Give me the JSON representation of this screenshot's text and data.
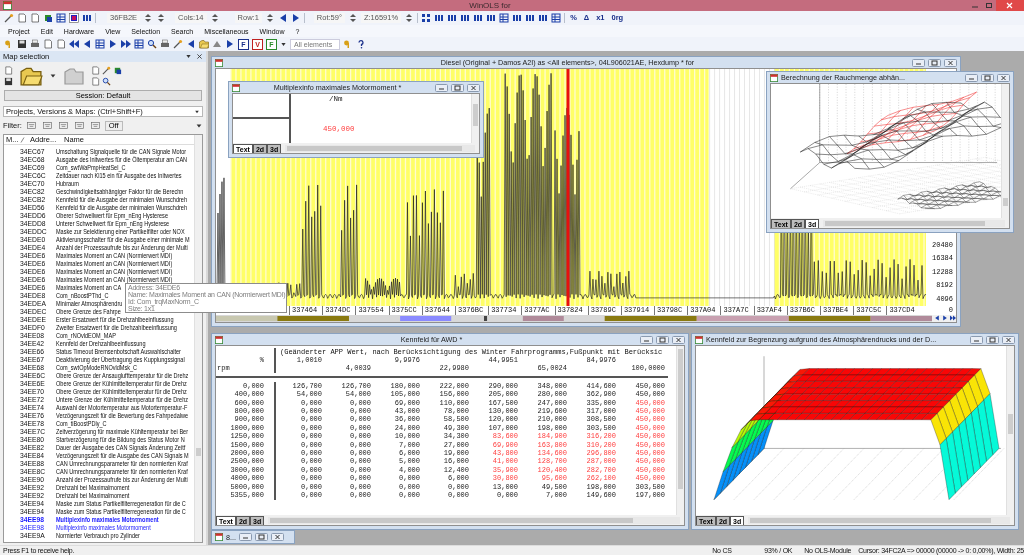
{
  "window": {
    "title": "WinOLS for"
  },
  "toolbar": {
    "address": "36FB2E",
    "cols": "Cols:14",
    "row": "Row:1",
    "rotation": "Rot:59°",
    "zoom": "Z:16591%",
    "value_modes": [
      "%",
      "Δ",
      "x1",
      "0rg"
    ]
  },
  "menu": [
    "Project",
    "Edit",
    "Hardware",
    "View",
    "Selection",
    "Search",
    "Miscellaneous",
    "Window",
    "?"
  ],
  "toolbar2": {
    "format_buttons": [
      "F",
      "V",
      "F"
    ],
    "element_filter": "All elements"
  },
  "map_selection": {
    "title": "Map selection",
    "session": "Session: Default",
    "search_mode": "Projects, Versions & Maps: (Ctrl+Shift+F)",
    "filter_label": "Filter:",
    "filter_off": "Off",
    "columns": [
      "M...",
      "Addre...",
      "Name"
    ],
    "rows": [
      {
        "address": "34EC67",
        "name": "Umschaltung Signalquelle für die CAN Signale Motor",
        "kind": "normal"
      },
      {
        "address": "34EC68",
        "name": "Ausgabe des Initwertes für die Öltemperatur am CAN",
        "kind": "normal"
      },
      {
        "address": "34EC69",
        "name": "Com_swtWaPmpHeatSel_C",
        "kind": "normal"
      },
      {
        "address": "34EC6C",
        "name": "Zeitdauer nach Kl15 ein für Ausgabe des Initwertes",
        "kind": "normal"
      },
      {
        "address": "34EC70",
        "name": "Hubraum",
        "kind": "normal"
      },
      {
        "address": "34EC82",
        "name": "Geschwindigkeitsabhängiger Faktor für die Berechn",
        "kind": "normal"
      },
      {
        "address": "34ECB2",
        "name": "Kennfeld für die Ausgabe der minimalen Wunschdreh",
        "kind": "normal"
      },
      {
        "address": "34ED56",
        "name": "Kennfeld für die Ausgabe der minimalen Wunschdreh",
        "kind": "normal"
      },
      {
        "address": "34EDD6",
        "name": "Oberer Schwellwert für Epm_nEng Hysterese",
        "kind": "normal"
      },
      {
        "address": "34EDD8",
        "name": "Unterer Schwellwert für Epm_nEng Hysterese",
        "kind": "normal"
      },
      {
        "address": "34EDDC",
        "name": "Maske zur Selektierung einer Partikelfilter oder NOX",
        "kind": "normal"
      },
      {
        "address": "34EDE0",
        "name": "Aktivierungsschalter für die Ausgabe einer minimale M",
        "kind": "normal"
      },
      {
        "address": "34EDE4",
        "name": "Anzahl der Prozessaufrufe bis zur Änderung der Multi",
        "kind": "normal"
      },
      {
        "address": "34EDE6",
        "name": "Maximales Moment an CAN (Normierwert MDI)",
        "kind": "normal"
      },
      {
        "address": "34EDE6",
        "name": "Maximales Moment an CAN (Normierwert MDI)",
        "kind": "normal"
      },
      {
        "address": "34EDE6",
        "name": "Maximales Moment an CAN (Normierwert MDI)",
        "kind": "normal"
      },
      {
        "address": "34EDE6",
        "name": "Maximales Moment an CAN (Normierwert MDI)",
        "kind": "normal"
      },
      {
        "address": "34EDE6",
        "name": "Maximales Moment an CA",
        "kind": "normal"
      },
      {
        "address": "34EDE8",
        "name": "Com_nBoostPThd_C",
        "kind": "normal"
      },
      {
        "address": "34EDEA",
        "name": "Minimaler Atmosphärendru",
        "kind": "normal"
      },
      {
        "address": "34EDEC",
        "name": "Obere Grenze des Fahrpe",
        "kind": "normal"
      },
      {
        "address": "34EDEE",
        "name": "Erster Ersatzwert für die Drehzahlbeeinflussung",
        "kind": "normal"
      },
      {
        "address": "34EDF0",
        "name": "Zweiter Ersatzwert für die Drehzahlbeeinflussung",
        "kind": "normal"
      },
      {
        "address": "34EE08",
        "name": "Com_rNOvldEOM_MAP",
        "kind": "normal"
      },
      {
        "address": "34EE42",
        "name": "Kennfeld der Drehzahlbeeinflussung",
        "kind": "normal"
      },
      {
        "address": "34EE66",
        "name": "Status Timeout Bremsenbotschaft Auswahlschalter",
        "kind": "normal"
      },
      {
        "address": "34EE67",
        "name": "Deaktivierung der Übertragung des Kupplungssignal",
        "kind": "normal"
      },
      {
        "address": "34EE68",
        "name": "Com_swtOpModeRNOvldMsk_C",
        "kind": "normal"
      },
      {
        "address": "34EE6C",
        "name": "Obere Grenze der Ansauglufttemperatur für die Drehz",
        "kind": "normal"
      },
      {
        "address": "34EE6E",
        "name": "Obere Grenze der Kühlmitteltemperatur für die Drehz",
        "kind": "normal"
      },
      {
        "address": "34EE70",
        "name": "Obere Grenze der Kühlmitteltemperatur für die Drehz",
        "kind": "normal"
      },
      {
        "address": "34EE72",
        "name": "Untere Grenze der Kühlmitteltemperatur für die Drehz",
        "kind": "normal"
      },
      {
        "address": "34EE74",
        "name": "Auswahl der Motortemperatur aus Motortemperatur-F",
        "kind": "normal"
      },
      {
        "address": "34EE76",
        "name": "Verzögerungszeit für die Bewertung des Fahrpedalwe",
        "kind": "normal"
      },
      {
        "address": "34EE78",
        "name": "Com_tiBoostPDly_C",
        "kind": "normal"
      },
      {
        "address": "34EE7C",
        "name": "Zeitverzögerung für maximale Kühltemperatur bei Ber",
        "kind": "normal"
      },
      {
        "address": "34EE80",
        "name": "Startverzögerung für die Bildung des Status Motor N",
        "kind": "normal"
      },
      {
        "address": "34EE82",
        "name": "Dauer der Ausgabe des CAN Signals Änderung Zeitf",
        "kind": "normal"
      },
      {
        "address": "34EE84",
        "name": "Verzögerungszeit für die Ausgabe des CAN Signals M",
        "kind": "normal"
      },
      {
        "address": "34EE88",
        "name": "CAN Umrechnungsparameter für den normierten Kraf",
        "kind": "normal"
      },
      {
        "address": "34EE8C",
        "name": "CAN Umrechnungsparameter für den normierten Kraf",
        "kind": "normal"
      },
      {
        "address": "34EE90",
        "name": "Anzahl der Prozessaufrufe bis zur Änderung der Multi",
        "kind": "normal"
      },
      {
        "address": "34EE92",
        "name": "Drehzahl bei Maximalmoment",
        "kind": "normal"
      },
      {
        "address": "34EE92",
        "name": "Drehzahl bei Maximalmoment",
        "kind": "normal"
      },
      {
        "address": "34EE94",
        "name": "Maske zum Status Partikelfilterregeneration für die C",
        "kind": "normal"
      },
      {
        "address": "34EE94",
        "name": "Maske zum Status Partikelfilterregeneration für die C",
        "kind": "normal"
      },
      {
        "address": "34EE98",
        "name": "Multiplexinfo maximales Motormoment",
        "kind": "current"
      },
      {
        "address": "34EE98",
        "name": "Multiplexinfo maximales Motormoment",
        "kind": "linked"
      },
      {
        "address": "34EE9A",
        "name": "Normierter Verbrauch pro Zylinder",
        "kind": "normal"
      }
    ]
  },
  "tooltip": {
    "lines": [
      "Address: 34EDE6",
      "Name: Maximales Moment an CAN (Normierwert MDI)",
      "Id: Com_trqMaxNorm_C",
      "Size: 1x1"
    ]
  },
  "hexdump": {
    "title": "Diesel (Original + Damos A2I) as <All elements>, 04L906021AE, Hexdump * for",
    "y_labels": [
      "20480",
      "16384",
      "12288",
      "8192",
      "4096",
      "0"
    ],
    "x_labels": [
      "337464",
      "3374DC",
      "337554",
      "3375CC",
      "337644",
      "3376BC",
      "337734",
      "3377AC",
      "337824",
      "33789C",
      "337914",
      "33798C",
      "337A04",
      "337A7C",
      "337AF4",
      "337B6C",
      "337BE4",
      "337C5C",
      "337CD4"
    ]
  },
  "multiplex": {
    "title": "Multiplexinfo maximales Motormoment *",
    "unit": "/Nm",
    "value": "450,000",
    "flagged": true,
    "tabs": [
      {
        "label": "Text",
        "selected": true
      },
      {
        "label": "2d",
        "selected": false
      },
      {
        "label": "3d",
        "selected": false
      }
    ]
  },
  "smoke": {
    "title": "Berechnung der Rauchmenge abhän...",
    "tabs": [
      {
        "label": "Text",
        "selected": false
      },
      {
        "label": "2d",
        "selected": false
      },
      {
        "label": "3d",
        "selected": true
      }
    ]
  },
  "awd": {
    "title": "Kennfeld für AWD *",
    "description": "(Geänderter APP Wert, nach Berücksichtigung des Winter Fahrprogramms,Fußpunkt mit Berücksic",
    "x_unit": "%",
    "y_unit": "rpm",
    "x_axis": [
      "1,0010",
      "4,0039",
      "9,9976",
      "22,9980",
      "44,9951",
      "65,0024",
      "84,9976",
      "100,0000"
    ],
    "rows": [
      {
        "rpm": "0,000",
        "values": [
          "126,700",
          "126,700",
          "180,000",
          "222,000",
          "290,000",
          "348,000",
          "414,600",
          "450,000"
        ],
        "flagged": [
          false,
          false,
          false,
          false,
          false,
          false,
          false,
          false
        ]
      },
      {
        "rpm": "400,000",
        "values": [
          "54,000",
          "54,000",
          "105,000",
          "156,000",
          "205,000",
          "280,000",
          "362,900",
          "450,000"
        ],
        "flagged": [
          false,
          false,
          false,
          false,
          false,
          false,
          false,
          false
        ]
      },
      {
        "rpm": "600,000",
        "values": [
          "0,000",
          "0,000",
          "69,000",
          "110,000",
          "167,500",
          "247,000",
          "335,000",
          "450,000"
        ],
        "flagged": [
          false,
          false,
          false,
          false,
          false,
          false,
          false,
          true
        ]
      },
      {
        "rpm": "800,000",
        "values": [
          "0,000",
          "0,000",
          "43,000",
          "78,000",
          "130,000",
          "219,600",
          "317,000",
          "450,000"
        ],
        "flagged": [
          false,
          false,
          false,
          false,
          false,
          false,
          false,
          true
        ]
      },
      {
        "rpm": "900,000",
        "values": [
          "0,000",
          "0,000",
          "36,000",
          "58,500",
          "120,000",
          "210,000",
          "308,500",
          "450,000"
        ],
        "flagged": [
          false,
          false,
          false,
          false,
          false,
          false,
          false,
          true
        ]
      },
      {
        "rpm": "1000,000",
        "values": [
          "0,000",
          "0,000",
          "24,000",
          "49,300",
          "107,000",
          "198,000",
          "303,500",
          "450,000"
        ],
        "flagged": [
          false,
          false,
          false,
          false,
          false,
          false,
          false,
          true
        ]
      },
      {
        "rpm": "1250,000",
        "values": [
          "0,000",
          "0,000",
          "10,000",
          "34,300",
          "83,600",
          "184,900",
          "316,200",
          "450,000"
        ],
        "flagged": [
          false,
          false,
          false,
          false,
          true,
          true,
          true,
          true
        ]
      },
      {
        "rpm": "1500,000",
        "values": [
          "0,000",
          "0,000",
          "7,000",
          "27,000",
          "69,900",
          "163,800",
          "310,200",
          "450,000"
        ],
        "flagged": [
          false,
          false,
          false,
          false,
          true,
          true,
          true,
          true
        ]
      },
      {
        "rpm": "2000,000",
        "values": [
          "0,000",
          "0,000",
          "6,000",
          "19,000",
          "43,800",
          "134,600",
          "296,800",
          "450,000"
        ],
        "flagged": [
          false,
          false,
          false,
          false,
          true,
          true,
          true,
          true
        ]
      },
      {
        "rpm": "2500,000",
        "values": [
          "0,000",
          "0,000",
          "5,000",
          "16,000",
          "41,000",
          "128,700",
          "287,000",
          "450,000"
        ],
        "flagged": [
          false,
          false,
          false,
          false,
          true,
          true,
          true,
          true
        ]
      },
      {
        "rpm": "3000,000",
        "values": [
          "0,000",
          "0,000",
          "4,000",
          "12,400",
          "35,900",
          "120,400",
          "282,700",
          "450,000"
        ],
        "flagged": [
          false,
          false,
          false,
          false,
          true,
          true,
          true,
          true
        ]
      },
      {
        "rpm": "4000,000",
        "values": [
          "0,000",
          "0,000",
          "0,000",
          "6,000",
          "30,800",
          "95,600",
          "262,100",
          "450,000"
        ],
        "flagged": [
          false,
          false,
          false,
          false,
          true,
          true,
          true,
          true
        ]
      },
      {
        "rpm": "5000,000",
        "values": [
          "0,000",
          "0,000",
          "0,000",
          "0,000",
          "13,000",
          "49,500",
          "198,000",
          "303,500"
        ],
        "flagged": [
          false,
          false,
          false,
          false,
          false,
          false,
          false,
          false
        ]
      },
      {
        "rpm": "5355,000",
        "values": [
          "0,000",
          "0,000",
          "0,000",
          "0,000",
          "0,000",
          "7,000",
          "149,600",
          "197,000"
        ],
        "flagged": [
          false,
          false,
          false,
          false,
          false,
          false,
          false,
          false
        ]
      }
    ],
    "tabs": [
      {
        "label": "Text",
        "selected": true
      },
      {
        "label": "2d",
        "selected": false
      },
      {
        "label": "3d",
        "selected": false
      }
    ]
  },
  "limit": {
    "title": "Kennfeld zur Begrenzung aufgrund des Atmosphärendrucks und der D...",
    "tabs": [
      {
        "label": "Text",
        "selected": false
      },
      {
        "label": "2d",
        "selected": false
      },
      {
        "label": "3d",
        "selected": true
      }
    ]
  },
  "minimized": {
    "title": "8..."
  },
  "status_bar": {
    "help": "Press F1 to receive help.",
    "checksum": "No CS",
    "progress": "93% / OK",
    "module": "No OLS-Module",
    "cursor": "Cursor: 34FC2A => 00000 (00000 -> 0: 0,00%), Width: 25"
  }
}
